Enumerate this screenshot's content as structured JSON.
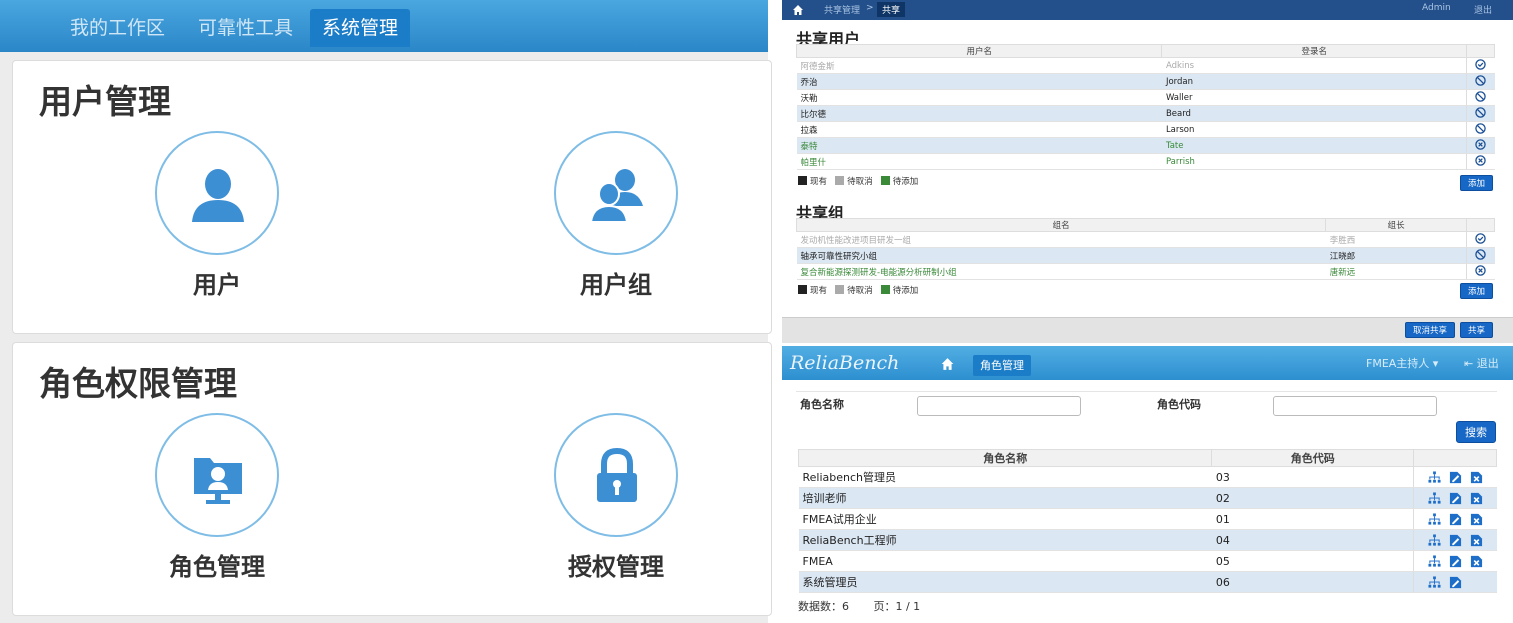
{
  "left": {
    "nav": {
      "tabs": [
        "我的工作区",
        "可靠性工具",
        "系统管理"
      ],
      "active_tab": "系统管理"
    },
    "user_section": {
      "title": "用户管理",
      "tiles": [
        "用户",
        "用户组"
      ]
    },
    "role_section": {
      "title": "角色权限管理",
      "tiles": [
        "角色管理",
        "授权管理"
      ]
    }
  },
  "share": {
    "breadcrumb": {
      "parent": "共享管理",
      "separator": ">",
      "current": "共享"
    },
    "user_name": "Admin",
    "logout": "退出",
    "users": {
      "title": "共享用户",
      "columns": [
        "用户名",
        "登录名"
      ],
      "rows": [
        {
          "name": "阿德金斯",
          "login": "Adkins",
          "state": "pending-cancel"
        },
        {
          "name": "乔治",
          "login": "Jordan",
          "state": "existing"
        },
        {
          "name": "沃勒",
          "login": "Waller",
          "state": "existing"
        },
        {
          "name": "比尔德",
          "login": "Beard",
          "state": "existing"
        },
        {
          "name": "拉森",
          "login": "Larson",
          "state": "existing"
        },
        {
          "name": "泰特",
          "login": "Tate",
          "state": "pending-add"
        },
        {
          "name": "帕里什",
          "login": "Parrish",
          "state": "pending-add"
        }
      ],
      "add_label": "添加"
    },
    "groups": {
      "title": "共享组",
      "columns": [
        "组名",
        "组长"
      ],
      "rows": [
        {
          "name": "发动机性能改进项目研发一组",
          "leader": "李胜西",
          "state": "pending-cancel"
        },
        {
          "name": "轴承可靠性研究小组",
          "leader": "江晓郎",
          "state": "existing"
        },
        {
          "name": "复合新能源探测研发-电能源分析研制小组",
          "leader": "唐新远",
          "state": "pending-add"
        }
      ],
      "add_label": "添加"
    },
    "legend": {
      "existing": "现有",
      "pending_cancel": "待取消",
      "pending_add": "待添加"
    },
    "footer": {
      "cancel_share": "取消共享",
      "share": "共享"
    },
    "colors": {
      "existing": "#222222",
      "pending_cancel": "#aaaaaa",
      "pending_add": "#3a8a3a"
    }
  },
  "roles": {
    "logo": "ReliaBench",
    "tab": "角色管理",
    "user_menu": "FMEA主持人",
    "logout": "退出",
    "search": {
      "name_label": "角色名称",
      "code_label": "角色代码",
      "button": "搜索"
    },
    "table": {
      "columns": [
        "角色名称",
        "角色代码"
      ],
      "rows": [
        {
          "name": "Reliabench管理员",
          "code": "03",
          "deletable": true
        },
        {
          "name": "培训老师",
          "code": "02",
          "deletable": true
        },
        {
          "name": "FMEA试用企业",
          "code": "01",
          "deletable": true
        },
        {
          "name": "ReliaBench工程师",
          "code": "04",
          "deletable": true
        },
        {
          "name": "FMEA",
          "code": "05",
          "deletable": true
        },
        {
          "name": "系统管理员",
          "code": "06",
          "deletable": false
        }
      ]
    },
    "status": {
      "count_label": "数据数：",
      "count": "6",
      "page_label": "页：",
      "page": "1 / 1"
    }
  }
}
